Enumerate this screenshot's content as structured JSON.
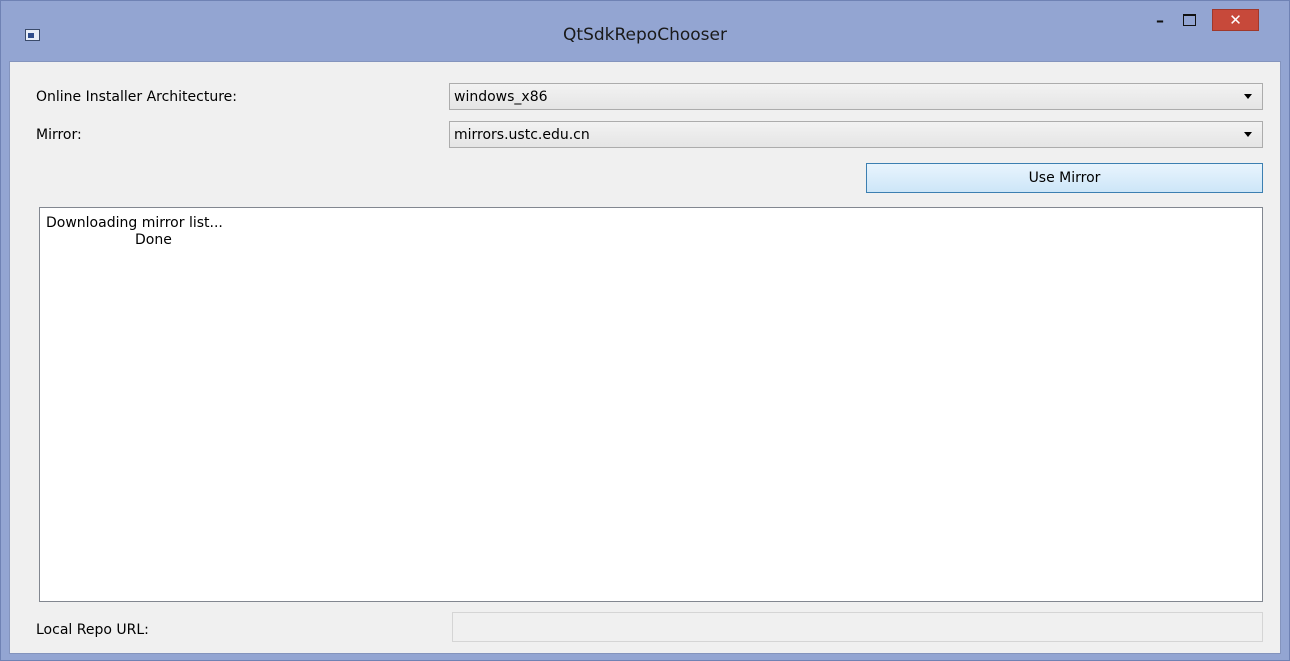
{
  "window": {
    "title": "QtSdkRepoChooser",
    "minimize_glyph": "–",
    "close_glyph": "✕",
    "icon": "app-window-icon"
  },
  "form": {
    "arch_label": "Online Installer Architecture:",
    "arch_value": "windows_x86",
    "mirror_label": "Mirror:",
    "mirror_value": "mirrors.ustc.edu.cn",
    "use_mirror_button": "Use Mirror",
    "log_line1": "Downloading mirror list...",
    "log_line2": "                    Done",
    "local_repo_label": "Local Repo URL:",
    "local_repo_value": ""
  }
}
